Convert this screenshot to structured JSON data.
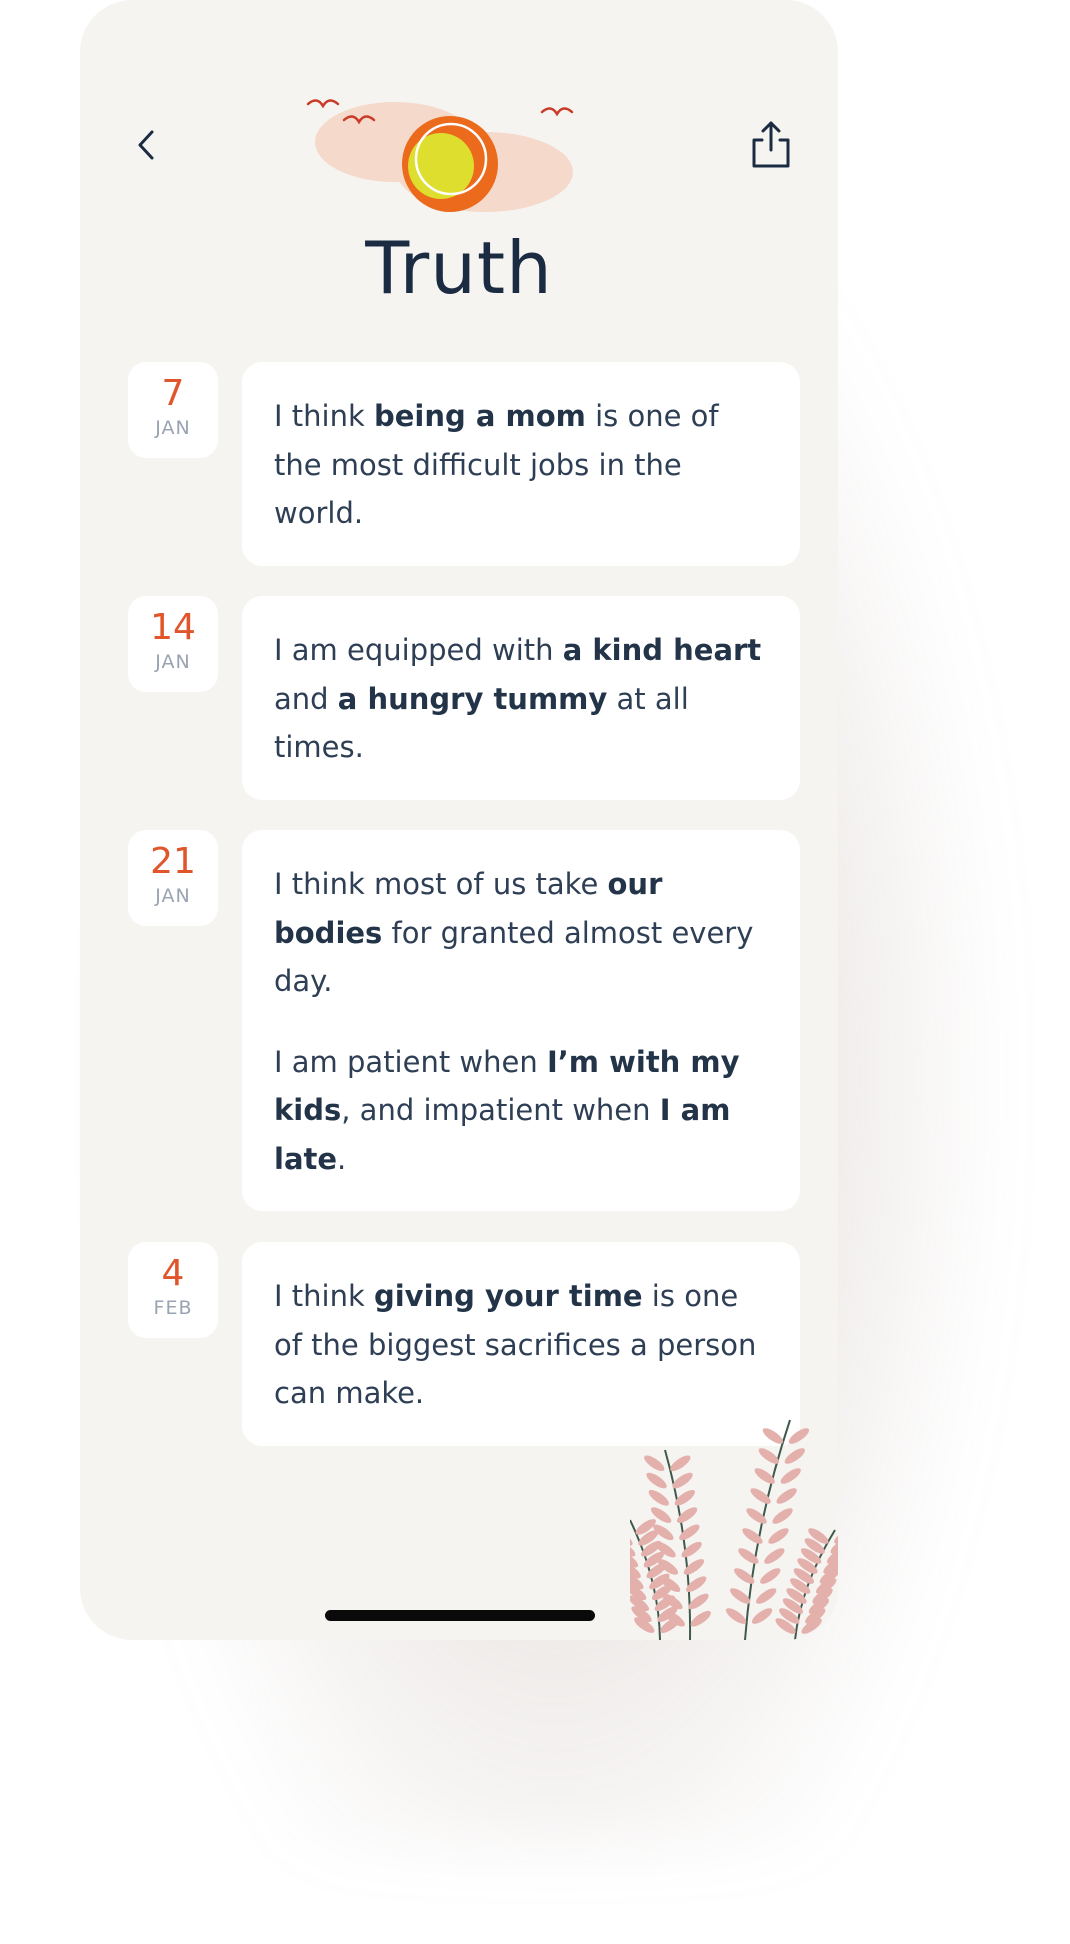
{
  "screen": {
    "title": "Truth",
    "back_icon": "chevron-left-icon",
    "share_icon": "share-icon"
  },
  "entries": [
    {
      "day": "7",
      "month": "JAN",
      "paragraphs": [
        [
          {
            "t": "I think "
          },
          {
            "t": "being a mom",
            "b": true
          },
          {
            "t": " is one of the most difficult jobs in the world."
          }
        ]
      ]
    },
    {
      "day": "14",
      "month": "JAN",
      "paragraphs": [
        [
          {
            "t": "I am equipped with "
          },
          {
            "t": "a kind heart",
            "b": true
          },
          {
            "t": " and "
          },
          {
            "t": "a hungry tummy",
            "b": true
          },
          {
            "t": " at all times."
          }
        ]
      ]
    },
    {
      "day": "21",
      "month": "JAN",
      "paragraphs": [
        [
          {
            "t": "I think most of us take "
          },
          {
            "t": "our bodies",
            "b": true
          },
          {
            "t": " for granted almost every day."
          }
        ],
        [
          {
            "t": "I am patient when "
          },
          {
            "t": "I’m with my kids",
            "b": true
          },
          {
            "t": ", and impatient when "
          },
          {
            "t": "I am late",
            "b": true
          },
          {
            "t": "."
          }
        ]
      ]
    },
    {
      "day": "4",
      "month": "FEB",
      "paragraphs": [
        [
          {
            "t": "I think "
          },
          {
            "t": "giving your time",
            "b": true
          },
          {
            "t": " is one of the biggest sacrifices a person can make."
          }
        ]
      ]
    }
  ],
  "colors": {
    "background": "#f6f4f1",
    "card": "#ffffff",
    "date_number": "#e1552a",
    "title": "#1b2b42",
    "sun_outer": "#ec6a1c",
    "sun_inner": "#dede2e",
    "cloud": "#f5d9cb",
    "bird": "#c93b27",
    "plant_leaf": "#e4b0ac",
    "plant_stem": "#3e5a4d"
  }
}
